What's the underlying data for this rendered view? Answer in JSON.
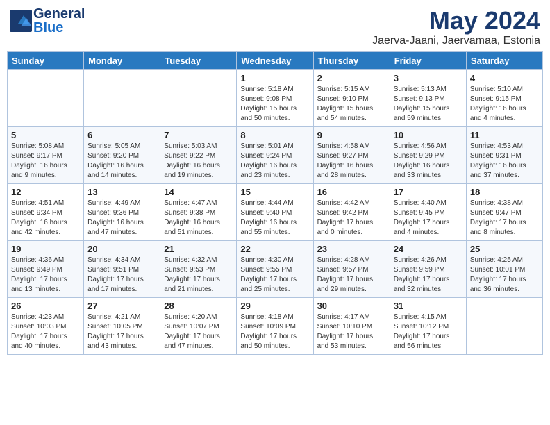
{
  "header": {
    "logo_general": "General",
    "logo_blue": "Blue",
    "month_title": "May 2024",
    "location": "Jaerva-Jaani, Jaervamaa, Estonia"
  },
  "days_of_week": [
    "Sunday",
    "Monday",
    "Tuesday",
    "Wednesday",
    "Thursday",
    "Friday",
    "Saturday"
  ],
  "weeks": [
    [
      {
        "day": "",
        "info": ""
      },
      {
        "day": "",
        "info": ""
      },
      {
        "day": "",
        "info": ""
      },
      {
        "day": "1",
        "info": "Sunrise: 5:18 AM\nSunset: 9:08 PM\nDaylight: 15 hours\nand 50 minutes."
      },
      {
        "day": "2",
        "info": "Sunrise: 5:15 AM\nSunset: 9:10 PM\nDaylight: 15 hours\nand 54 minutes."
      },
      {
        "day": "3",
        "info": "Sunrise: 5:13 AM\nSunset: 9:13 PM\nDaylight: 15 hours\nand 59 minutes."
      },
      {
        "day": "4",
        "info": "Sunrise: 5:10 AM\nSunset: 9:15 PM\nDaylight: 16 hours\nand 4 minutes."
      }
    ],
    [
      {
        "day": "5",
        "info": "Sunrise: 5:08 AM\nSunset: 9:17 PM\nDaylight: 16 hours\nand 9 minutes."
      },
      {
        "day": "6",
        "info": "Sunrise: 5:05 AM\nSunset: 9:20 PM\nDaylight: 16 hours\nand 14 minutes."
      },
      {
        "day": "7",
        "info": "Sunrise: 5:03 AM\nSunset: 9:22 PM\nDaylight: 16 hours\nand 19 minutes."
      },
      {
        "day": "8",
        "info": "Sunrise: 5:01 AM\nSunset: 9:24 PM\nDaylight: 16 hours\nand 23 minutes."
      },
      {
        "day": "9",
        "info": "Sunrise: 4:58 AM\nSunset: 9:27 PM\nDaylight: 16 hours\nand 28 minutes."
      },
      {
        "day": "10",
        "info": "Sunrise: 4:56 AM\nSunset: 9:29 PM\nDaylight: 16 hours\nand 33 minutes."
      },
      {
        "day": "11",
        "info": "Sunrise: 4:53 AM\nSunset: 9:31 PM\nDaylight: 16 hours\nand 37 minutes."
      }
    ],
    [
      {
        "day": "12",
        "info": "Sunrise: 4:51 AM\nSunset: 9:34 PM\nDaylight: 16 hours\nand 42 minutes."
      },
      {
        "day": "13",
        "info": "Sunrise: 4:49 AM\nSunset: 9:36 PM\nDaylight: 16 hours\nand 47 minutes."
      },
      {
        "day": "14",
        "info": "Sunrise: 4:47 AM\nSunset: 9:38 PM\nDaylight: 16 hours\nand 51 minutes."
      },
      {
        "day": "15",
        "info": "Sunrise: 4:44 AM\nSunset: 9:40 PM\nDaylight: 16 hours\nand 55 minutes."
      },
      {
        "day": "16",
        "info": "Sunrise: 4:42 AM\nSunset: 9:42 PM\nDaylight: 17 hours\nand 0 minutes."
      },
      {
        "day": "17",
        "info": "Sunrise: 4:40 AM\nSunset: 9:45 PM\nDaylight: 17 hours\nand 4 minutes."
      },
      {
        "day": "18",
        "info": "Sunrise: 4:38 AM\nSunset: 9:47 PM\nDaylight: 17 hours\nand 8 minutes."
      }
    ],
    [
      {
        "day": "19",
        "info": "Sunrise: 4:36 AM\nSunset: 9:49 PM\nDaylight: 17 hours\nand 13 minutes."
      },
      {
        "day": "20",
        "info": "Sunrise: 4:34 AM\nSunset: 9:51 PM\nDaylight: 17 hours\nand 17 minutes."
      },
      {
        "day": "21",
        "info": "Sunrise: 4:32 AM\nSunset: 9:53 PM\nDaylight: 17 hours\nand 21 minutes."
      },
      {
        "day": "22",
        "info": "Sunrise: 4:30 AM\nSunset: 9:55 PM\nDaylight: 17 hours\nand 25 minutes."
      },
      {
        "day": "23",
        "info": "Sunrise: 4:28 AM\nSunset: 9:57 PM\nDaylight: 17 hours\nand 29 minutes."
      },
      {
        "day": "24",
        "info": "Sunrise: 4:26 AM\nSunset: 9:59 PM\nDaylight: 17 hours\nand 32 minutes."
      },
      {
        "day": "25",
        "info": "Sunrise: 4:25 AM\nSunset: 10:01 PM\nDaylight: 17 hours\nand 36 minutes."
      }
    ],
    [
      {
        "day": "26",
        "info": "Sunrise: 4:23 AM\nSunset: 10:03 PM\nDaylight: 17 hours\nand 40 minutes."
      },
      {
        "day": "27",
        "info": "Sunrise: 4:21 AM\nSunset: 10:05 PM\nDaylight: 17 hours\nand 43 minutes."
      },
      {
        "day": "28",
        "info": "Sunrise: 4:20 AM\nSunset: 10:07 PM\nDaylight: 17 hours\nand 47 minutes."
      },
      {
        "day": "29",
        "info": "Sunrise: 4:18 AM\nSunset: 10:09 PM\nDaylight: 17 hours\nand 50 minutes."
      },
      {
        "day": "30",
        "info": "Sunrise: 4:17 AM\nSunset: 10:10 PM\nDaylight: 17 hours\nand 53 minutes."
      },
      {
        "day": "31",
        "info": "Sunrise: 4:15 AM\nSunset: 10:12 PM\nDaylight: 17 hours\nand 56 minutes."
      },
      {
        "day": "",
        "info": ""
      }
    ]
  ]
}
